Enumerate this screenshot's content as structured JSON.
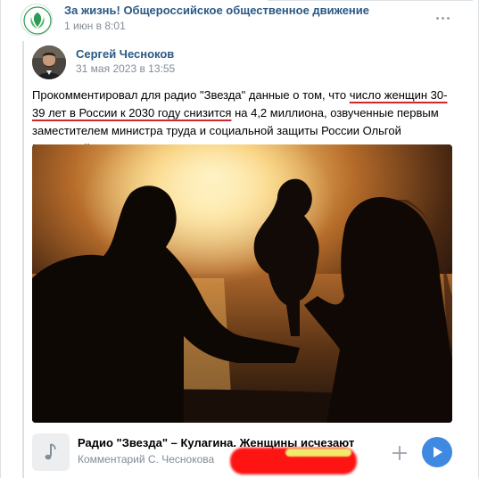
{
  "post": {
    "group_name": "За жизнь! Общероссийское общественное движение",
    "date": "1 июн в 8:01"
  },
  "repost": {
    "author_name": "Сергей Чесноков",
    "author_date": "31 мая 2023 в 13:55",
    "text_parts": {
      "p1": "Прокомментировал для радио \"Звезда\" данные о том, что ",
      "p2": "число женщин 30-39 лет в России к 2030 году снизится",
      "p3": " на 4,2 миллиона, озвученные первым заместителем министра труда и социальной защиты России Ольгой Баталиной."
    }
  },
  "audio": {
    "title": "Радио \"Звезда\" – Кулагина. Женщины исчезают",
    "subtitle": "Комментарий С. Чеснокова"
  },
  "icons": {
    "group_logo": "leaf-logo-icon",
    "more": "more-horizontal-icon",
    "audio": "music-note-icon",
    "add": "plus-icon",
    "play": "play-icon"
  },
  "colors": {
    "link": "#2a5885",
    "play": "#3f8ae0",
    "underline": "#d3262b",
    "redaction": "#ff1414"
  }
}
